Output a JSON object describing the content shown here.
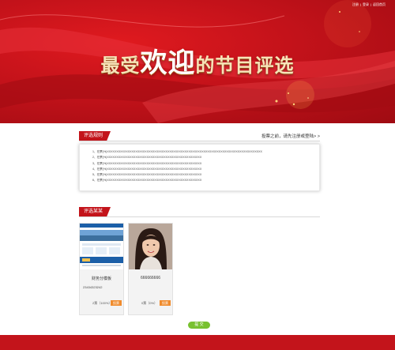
{
  "header": {
    "links": [
      "注册",
      "登录",
      "返回首页"
    ],
    "separator": "|",
    "title_part1": "最受",
    "title_part2": "欢迎",
    "title_part3": "的节目评选"
  },
  "rules": {
    "tab_label": "评选规则",
    "vote_note": "投票之前，请先注册或登陆> >",
    "items": [
      "1、在票(%)XXXXXXXXXXXXXXXXXXXXXXXXXXXXXXXXXXXXXXXXXXXXXXXXXXXXXXXXXXXXXXXXXXXXXXXXXXXXXXXXXX",
      "2、在票(%)XXXXXXXXXXXXXXXXXXXXXXXXXXXXXXXXXXXXXXXXXXXXXXXXXX",
      "3、在票(%)XXXXXXXXXXXXXXXXXXXXXXXXXXXXXXXXXXXXXXXXXXXXXXXXXX",
      "4、在票(%)XXXXXXXXXXXXXXXXXXXXXXXXXXXXXXXXXXXXXXXXXXXXXXXXXX",
      "5、在票(%)XXXXXXXXXXXXXXXXXXXXXXXXXXXXXXXXXXXXXXXXXXXXXXXXXX",
      "6、在票(%)XXXXXXXXXXXXXXXXXXXXXXXXXXXXXXXXXXXXXXXXXXXXXXXXXX"
    ]
  },
  "candidates": {
    "tab_label": "评选某某",
    "cards": [
      {
        "name": "财务分模板",
        "phone": "23434323242",
        "votes": "2票（100%）",
        "vote_label": "投票"
      },
      {
        "name": "666666666",
        "phone": "",
        "votes": "0票（0%）",
        "vote_label": "投票"
      }
    ]
  },
  "submit_label": "提 交",
  "colors": {
    "brand_red": "#c3141b",
    "vote_orange": "#f08c2e",
    "submit_green": "#78c12f",
    "title_gold": "#f7e3b8"
  }
}
